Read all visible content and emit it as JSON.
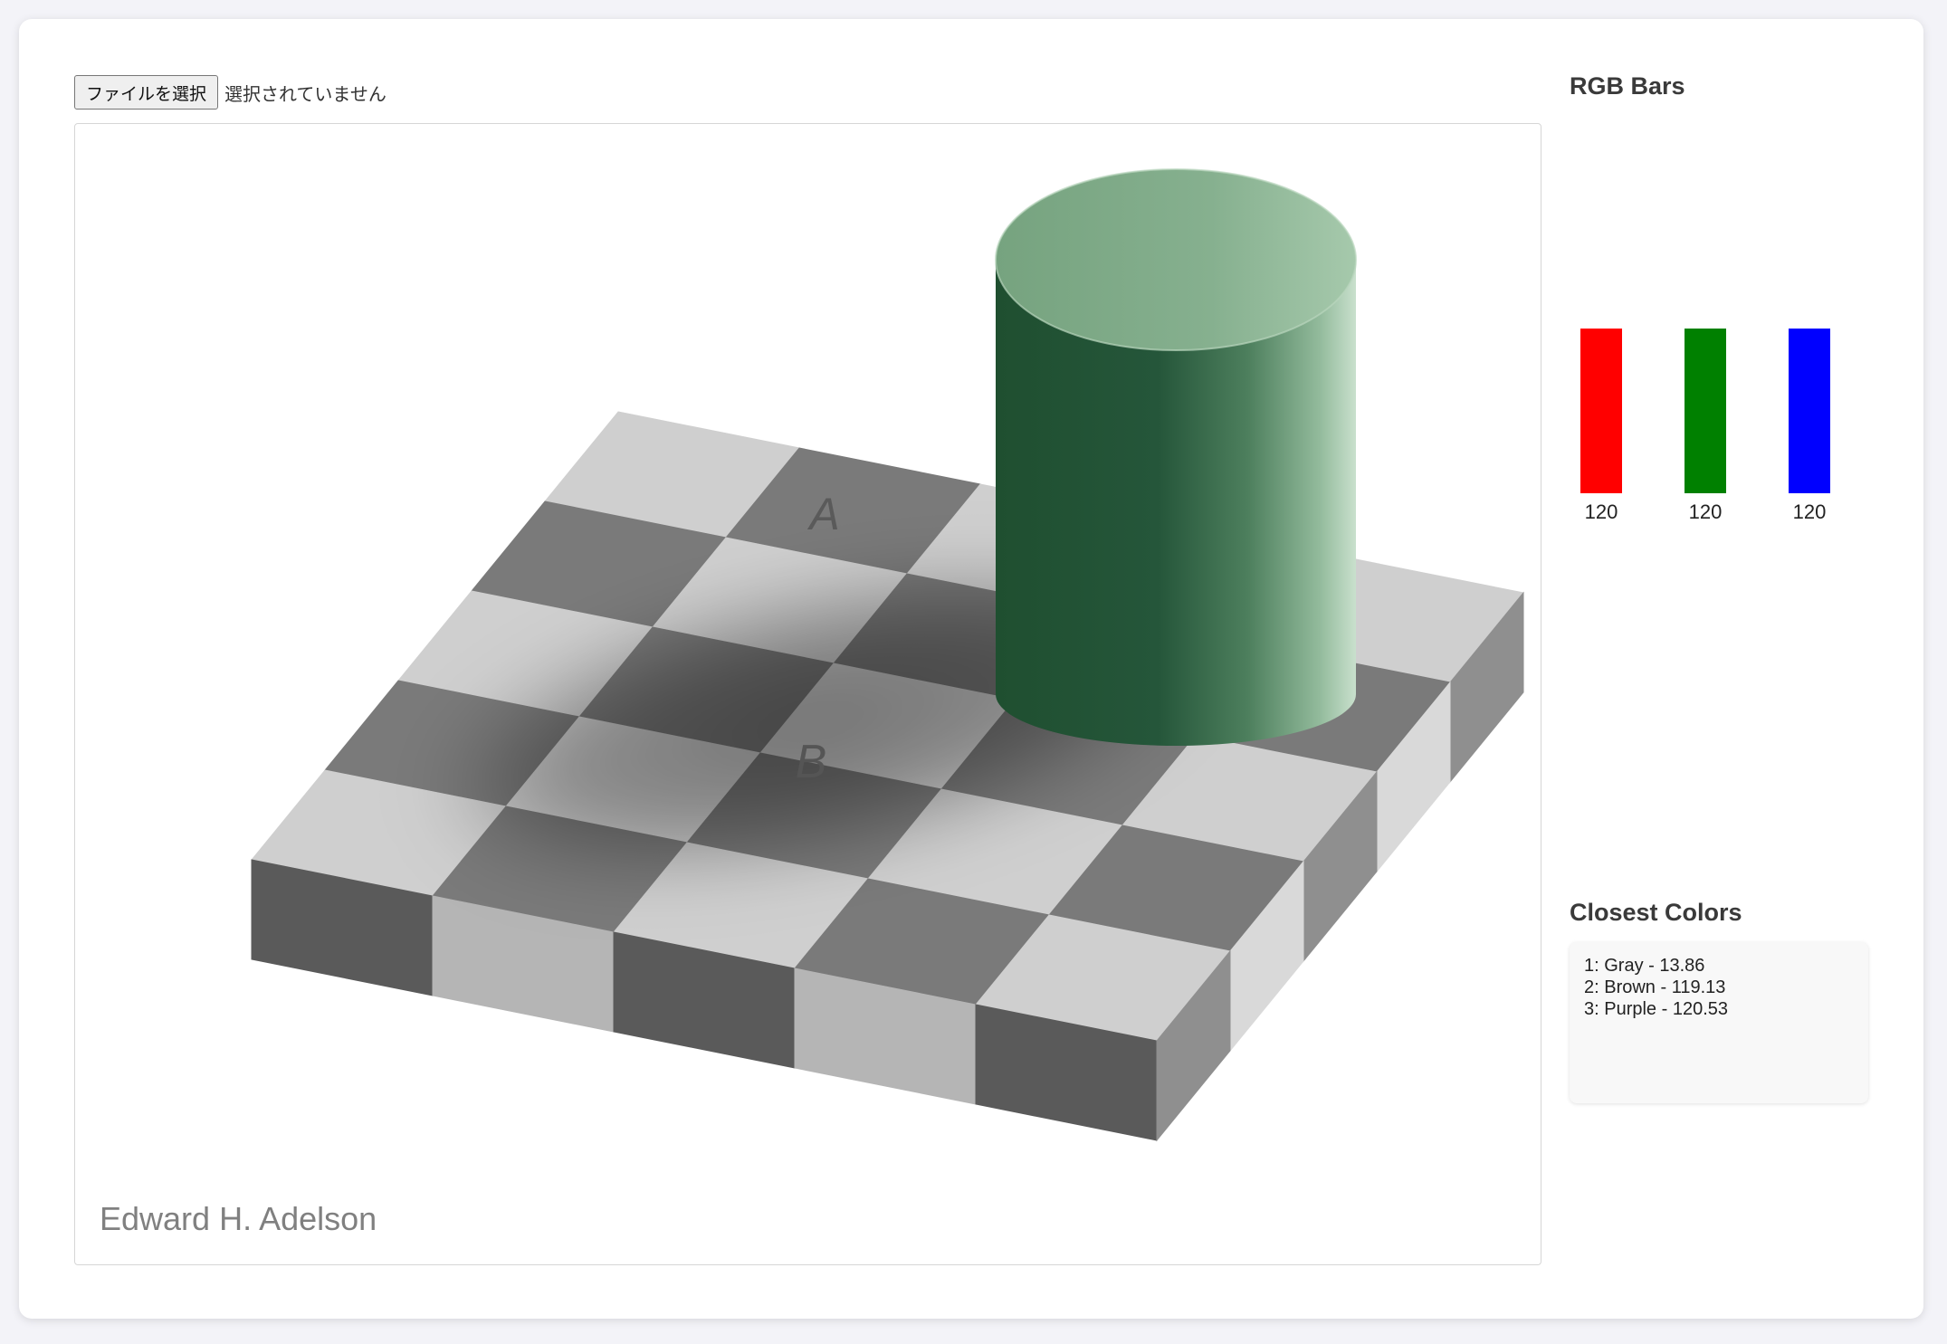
{
  "file_input": {
    "button_label": "ファイルを選択",
    "status_text": "選択されていません"
  },
  "image": {
    "label_a": "A",
    "label_b": "B",
    "credit": "Edward H. Adelson"
  },
  "rgb_bars": {
    "title": "RGB Bars",
    "bars": [
      {
        "channel": "R",
        "value": "120",
        "color": "#ff0000"
      },
      {
        "channel": "G",
        "value": "120",
        "color": "#008000"
      },
      {
        "channel": "B",
        "value": "120",
        "color": "#0000ff"
      }
    ]
  },
  "closest_colors": {
    "title": "Closest Colors",
    "items": [
      "1: Gray - 13.86",
      "2: Brown - 119.13",
      "3: Purple - 120.53"
    ]
  }
}
